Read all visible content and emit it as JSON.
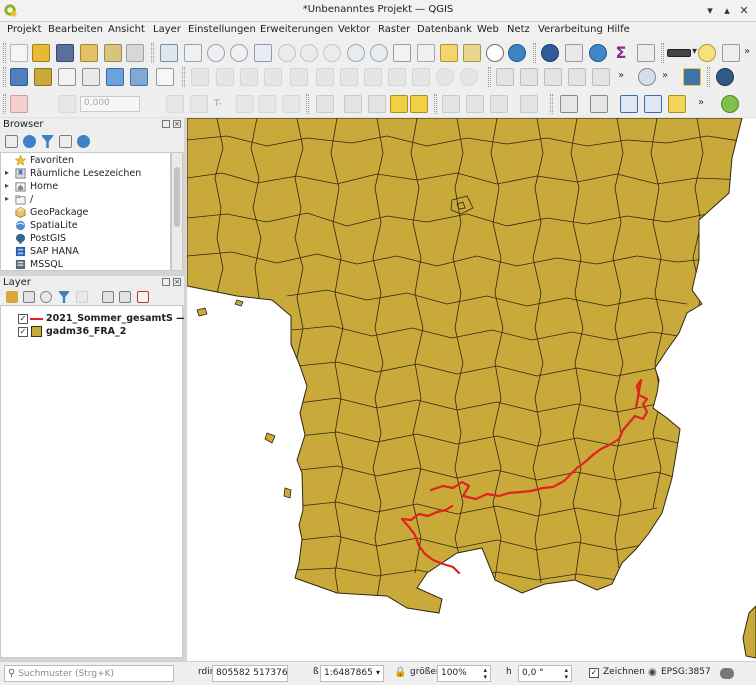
{
  "window": {
    "title": "*Unbenanntes Projekt — QGIS"
  },
  "menu": [
    "Projekt",
    "Bearbeiten",
    "Ansicht",
    "Layer",
    "Einstellungen",
    "Erweiterungen",
    "Vektor",
    "Raster",
    "Datenbank",
    "Web",
    "Netz",
    "Verarbeitung",
    "Hilfe"
  ],
  "toolbar3": {
    "width_value": "0,000"
  },
  "browser": {
    "title": "Browser",
    "items": [
      {
        "label": "Favoriten",
        "icon": "star-icon",
        "expandable": false
      },
      {
        "label": "Räumliche Lesezeichen",
        "icon": "bookmark-icon",
        "expandable": true
      },
      {
        "label": "Home",
        "icon": "home-folder-icon",
        "expandable": true
      },
      {
        "label": "/",
        "icon": "folder-icon",
        "expandable": true
      },
      {
        "label": "GeoPackage",
        "icon": "geopackage-icon",
        "expandable": false
      },
      {
        "label": "SpatiaLite",
        "icon": "spatialite-icon",
        "expandable": false
      },
      {
        "label": "PostGIS",
        "icon": "postgis-icon",
        "expandable": false
      },
      {
        "label": "SAP HANA",
        "icon": "sap-hana-icon",
        "expandable": false
      },
      {
        "label": "MSSQL",
        "icon": "mssql-icon",
        "expandable": false
      }
    ]
  },
  "layers": {
    "title": "Layer",
    "items": [
      {
        "name": "2021_Sommer_gesamtS —",
        "checked": true,
        "symbol": "line",
        "color": "#e0231e"
      },
      {
        "name": "gadm36_FRA_2",
        "checked": true,
        "symbol": "fill",
        "color": "#c9a93a"
      }
    ]
  },
  "map": {
    "fill_color": "#c9a93a",
    "border_color": "#3a3216",
    "track_color": "#e0231e"
  },
  "status": {
    "search_placeholder": "Suchmuster (Strg+K)",
    "coord_label": "rdir",
    "coord_value": "805582 5173763",
    "scale_label": "ß",
    "scale_value": "1:6487865",
    "magnifier_label": "größer",
    "magnifier_value": "100%",
    "rotation_label": "h",
    "rotation_value": "0,0 °",
    "render_label": "Zeichnen",
    "crs": "EPSG:3857"
  }
}
